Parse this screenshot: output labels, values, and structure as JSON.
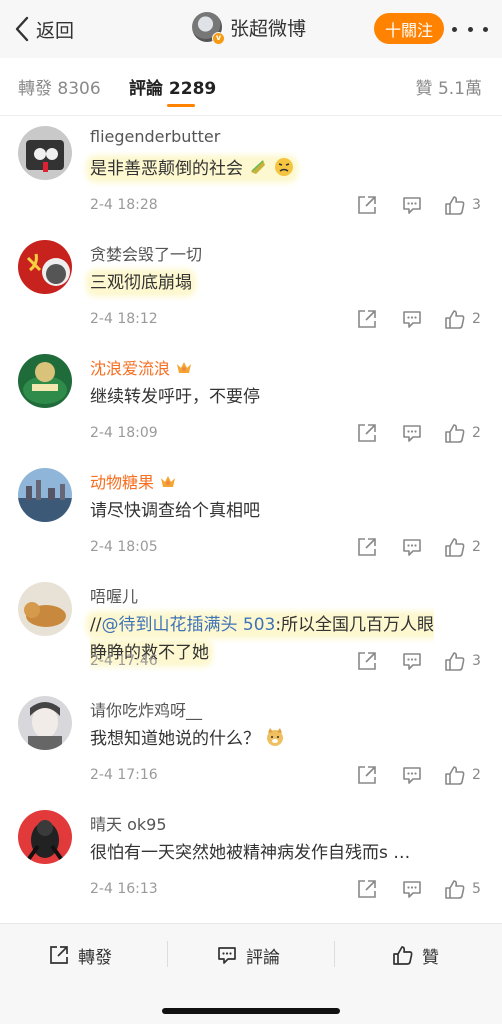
{
  "nav": {
    "back_label": "返回",
    "profile_name": "张超微博",
    "follow_label": "十關注",
    "verified_badge": "v"
  },
  "tabs": {
    "repost": "轉發 8306",
    "comment": "評論 2289",
    "like": "贊 5.1萬"
  },
  "comments": [
    {
      "name": "fliegenderbutter",
      "vip": false,
      "text": "是非善恶颠倒的社会",
      "emojis": [
        "leaf-emoji",
        "angry-emoji"
      ],
      "time": "2-4 18:28",
      "likes": "3"
    },
    {
      "name": "贪婪会毁了一切",
      "vip": false,
      "text": "三观彻底崩塌",
      "time": "2-4 18:12",
      "likes": "2"
    },
    {
      "name": "沈浪爱流浪",
      "vip": true,
      "text": "继续转发呼吁，不要停",
      "time": "2-4 18:09",
      "likes": "2"
    },
    {
      "name": "动物糖果",
      "vip": true,
      "text": "请尽快调查给个真相吧",
      "time": "2-4 18:05",
      "likes": "2"
    },
    {
      "name": "唔喔儿",
      "vip": false,
      "text_prefix": "//",
      "mention": "@待到山花插满头 503",
      "text_line1": ":所以全国几百万人眼",
      "text_line2": "睁睁的救不了她",
      "time": "2-4 17:46",
      "likes": "3"
    },
    {
      "name": "请你吃炸鸡呀__",
      "vip": false,
      "text": "我想知道她说的什么？",
      "emojis": [
        "doge-emoji"
      ],
      "time": "2-4 17:16",
      "likes": "2"
    },
    {
      "name": "晴天 ok95",
      "vip": false,
      "text": "很怕有一天突然她被精神病发作自残而s …",
      "time": "2-4 16:13",
      "likes": "5"
    }
  ],
  "bottom": {
    "repost": "轉發",
    "comment": "評論",
    "like": "贊"
  },
  "colors": {
    "accent": "#ff8200",
    "highlight": "#fdf8cf",
    "mention": "#3f73b8",
    "vip_name": "#f86e21"
  }
}
